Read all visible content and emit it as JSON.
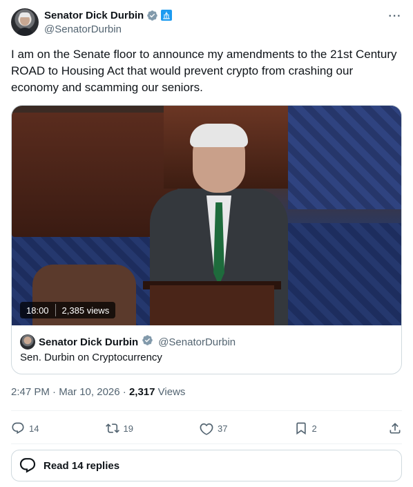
{
  "author": {
    "name": "Senator Dick Durbin",
    "handle": "@SenatorDurbin",
    "verified_color": "#829aab",
    "affiliation_badge_color": "#1d9bf0"
  },
  "tweet": {
    "text": "I am on the Senate floor to announce my amendments to the 21st Century ROAD to Housing Act that would prevent crypto from crashing our economy and scamming our seniors.",
    "time": "2:47 PM",
    "date": "Mar 10, 2026",
    "views_count": "2,317",
    "views_label": "Views"
  },
  "video_card": {
    "duration": "18:00",
    "views": "2,385 views",
    "author_name": "Senator Dick Durbin",
    "author_handle": "@SenatorDurbin",
    "title": "Sen. Durbin on Cryptocurrency"
  },
  "actions": {
    "replies": "14",
    "reposts": "19",
    "likes": "37",
    "bookmarks": "2"
  },
  "read_replies_label": "Read 14 replies"
}
